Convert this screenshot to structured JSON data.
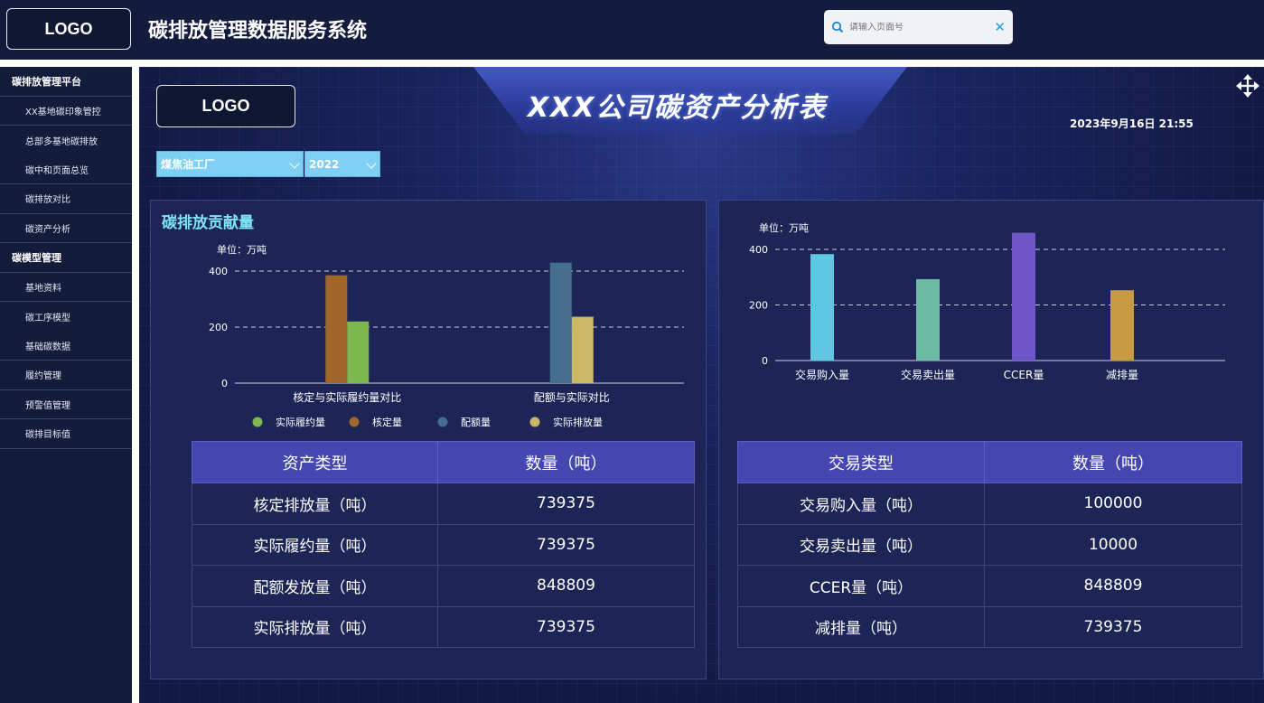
{
  "header": {
    "logo": "LOGO",
    "title": "碳排放管理数据服务系统",
    "search_placeholder": "请输入页面号"
  },
  "sidebar": {
    "items": [
      {
        "label": "碳排放管理平台",
        "type": "header"
      },
      {
        "label": "XX基地碳印象管控",
        "type": "sub"
      },
      {
        "label": "总部多基地碳排放",
        "type": "sub"
      },
      {
        "label": "碳中和页面总览",
        "type": "sub"
      },
      {
        "label": "碳排放对比",
        "type": "sub"
      },
      {
        "label": "碳资产分析",
        "type": "sub"
      },
      {
        "label": "碳模型管理",
        "type": "header"
      },
      {
        "label": "基地资料",
        "type": "sub"
      },
      {
        "label": "碳工序模型",
        "type": "sub"
      },
      {
        "label": "基础碳数据",
        "type": "sub"
      },
      {
        "label": "履约管理",
        "type": "sub"
      },
      {
        "label": "预警值管理",
        "type": "sub"
      },
      {
        "label": "碳排目标值",
        "type": "sub"
      }
    ]
  },
  "main": {
    "logo": "LOGO",
    "title": "XXX公司碳资产分析表",
    "datetime": "2023年9月16日 21:55",
    "factory_select": "煤焦油工厂",
    "year_select": "2022"
  },
  "left_panel": {
    "title": "碳排放贡献量",
    "unit": "单位：万吨",
    "table": {
      "headers": [
        "资产类型",
        "数量（吨）"
      ],
      "rows": [
        [
          "核定排放量（吨）",
          "739375"
        ],
        [
          "实际履约量（吨）",
          "739375"
        ],
        [
          "配额发放量（吨）",
          "848809"
        ],
        [
          "实际排放量（吨）",
          "739375"
        ]
      ]
    }
  },
  "right_panel": {
    "unit": "单位：万吨",
    "table": {
      "headers": [
        "交易类型",
        "数量（吨）"
      ],
      "rows": [
        [
          "交易购入量（吨）",
          "100000"
        ],
        [
          "交易卖出量（吨）",
          "10000"
        ],
        [
          "CCER量（吨）",
          "848809"
        ],
        [
          "减排量（吨）",
          "739375"
        ]
      ]
    }
  },
  "chart_data": [
    {
      "type": "bar",
      "categories": [
        "核定与实际履约量对比",
        "配额与实际对比"
      ],
      "ylim": [
        0,
        400
      ],
      "yticks": [
        0,
        200,
        400
      ],
      "grid": true,
      "legend_position": "bottom",
      "series": [
        {
          "name": "核定量",
          "color": "#a0662a",
          "values": [
            385,
            null
          ]
        },
        {
          "name": "实际履约量",
          "color": "#7fb74f",
          "values": [
            220,
            null
          ]
        },
        {
          "name": "配额量",
          "color": "#456d8d",
          "values": [
            null,
            430
          ]
        },
        {
          "name": "实际排放量",
          "color": "#cbb767",
          "values": [
            null,
            237
          ]
        }
      ],
      "legend": [
        {
          "name": "实际履约量",
          "color": "#7fb74f"
        },
        {
          "name": "核定量",
          "color": "#a0662a"
        },
        {
          "name": "配额量",
          "color": "#456d8d"
        },
        {
          "name": "实际排放量",
          "color": "#cbb767"
        }
      ]
    },
    {
      "type": "bar",
      "categories": [
        "交易购入量",
        "交易卖出量",
        "CCER量",
        "减排量"
      ],
      "values": [
        383,
        293,
        460,
        253
      ],
      "colors": [
        "#5ec6e0",
        "#6dbba2",
        "#7055c8",
        "#c89a45"
      ],
      "ylim": [
        0,
        400
      ],
      "yticks": [
        0,
        200,
        400
      ],
      "grid": true
    }
  ]
}
